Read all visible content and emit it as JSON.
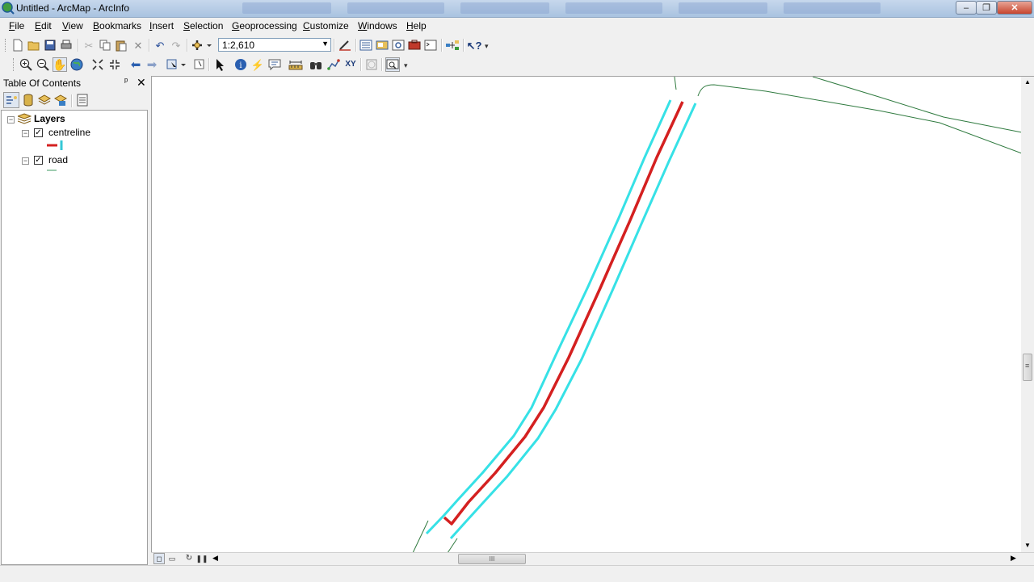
{
  "window": {
    "title": "Untitled - ArcMap - ArcInfo",
    "buttons": {
      "minimize": "–",
      "maximize": "❐",
      "close": "✕"
    }
  },
  "menu": {
    "items": [
      {
        "key": "F",
        "rest": "ile"
      },
      {
        "key": "E",
        "rest": "dit"
      },
      {
        "key": "V",
        "rest": "iew"
      },
      {
        "key": "B",
        "rest": "ookmarks"
      },
      {
        "key": "I",
        "rest": "nsert"
      },
      {
        "key": "S",
        "rest": "election"
      },
      {
        "key": "G",
        "rest": "eoprocessing"
      },
      {
        "key": "C",
        "rest": "ustomize"
      },
      {
        "key": "W",
        "rest": "indows"
      },
      {
        "key": "H",
        "rest": "elp"
      }
    ]
  },
  "standard_toolbar": {
    "scale": "1:2,610",
    "icons": [
      "new-doc-icon",
      "open-icon",
      "save-icon",
      "print-icon",
      "cut-icon",
      "copy-icon",
      "paste-icon",
      "delete-icon",
      "undo-icon",
      "redo-icon",
      "add-data-icon",
      "editor-toolbar-icon",
      "toc-window-icon",
      "catalog-icon",
      "search-window-icon",
      "arctoolbox-icon",
      "python-window-icon",
      "model-builder-icon",
      "whats-this-icon"
    ]
  },
  "tools_toolbar": {
    "icons": [
      "zoom-in-icon",
      "zoom-out-icon",
      "pan-icon",
      "full-extent-icon",
      "fixed-zoom-in-icon",
      "fixed-zoom-out-icon",
      "back-extent-icon",
      "forward-extent-icon",
      "select-features-icon",
      "clear-selection-icon",
      "select-elements-icon",
      "identify-icon",
      "hyperlink-icon",
      "html-popup-icon",
      "measure-icon",
      "find-icon",
      "find-route-icon",
      "go-to-xy-icon",
      "time-slider-icon",
      "create-viewer-icon"
    ]
  },
  "toc": {
    "title": "Table Of Contents",
    "pin": "ᵖ",
    "close": "✕",
    "root": {
      "label": "Layers"
    },
    "layers": [
      {
        "label": "centreline",
        "checked": true,
        "symbol_color": "#d42020",
        "secondary_color": "#35c7d6"
      },
      {
        "label": "road",
        "checked": true,
        "symbol_color": "#3c9a60"
      }
    ]
  },
  "map": {
    "colors": {
      "centreline": "#d42020",
      "buffer": "#36e1e6",
      "road": "#2f7a3f"
    }
  },
  "hscroll": {
    "thumb_label": "III"
  },
  "vscroll": {
    "thumb_label": "≡"
  }
}
